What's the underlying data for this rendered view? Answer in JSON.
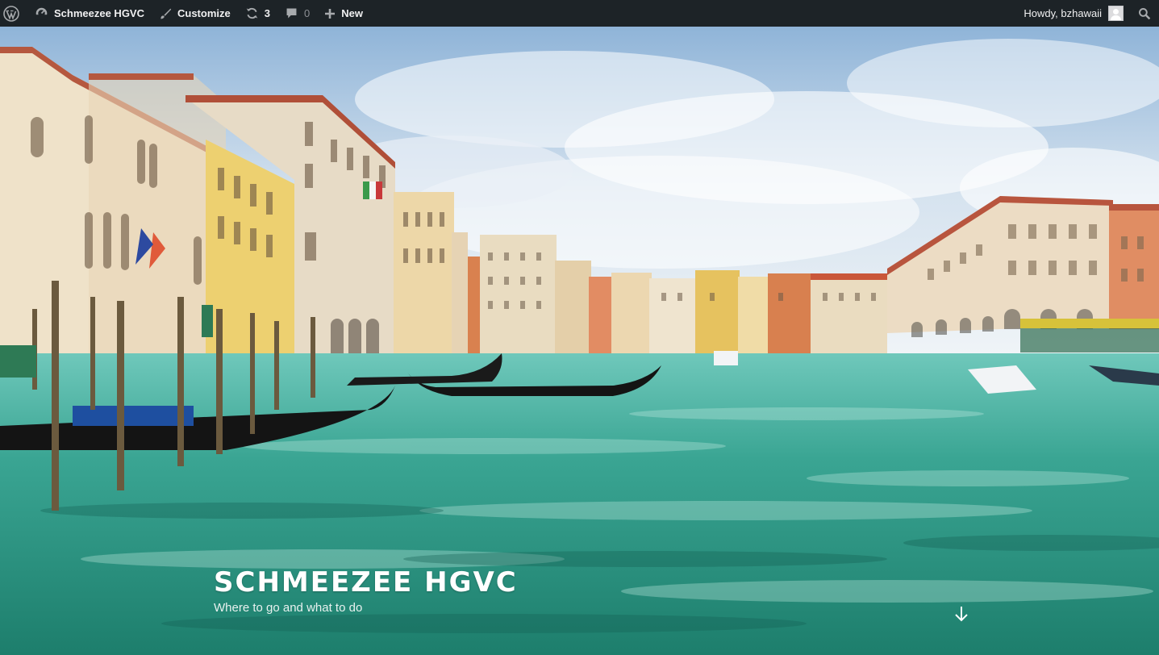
{
  "admin_bar": {
    "site_name": "Schmeezee HGVC",
    "customize_label": "Customize",
    "updates_count": "3",
    "comments_count": "0",
    "new_label": "New",
    "greeting": "Howdy, bzhawaii"
  },
  "header": {
    "site_title": "SCHMEEZEE HGVC",
    "site_description": "Where to go and what to do"
  },
  "colors": {
    "admin_bar_bg": "#1d2327",
    "admin_bar_text": "#f0f0f1",
    "sky": "#cfe1f2",
    "water": "#2f9e8a"
  },
  "icons": [
    "wordpress-logo-icon",
    "dashboard-icon",
    "brush-icon",
    "refresh-icon",
    "comment-icon",
    "plus-icon",
    "avatar",
    "search-icon",
    "arrow-down-icon"
  ]
}
